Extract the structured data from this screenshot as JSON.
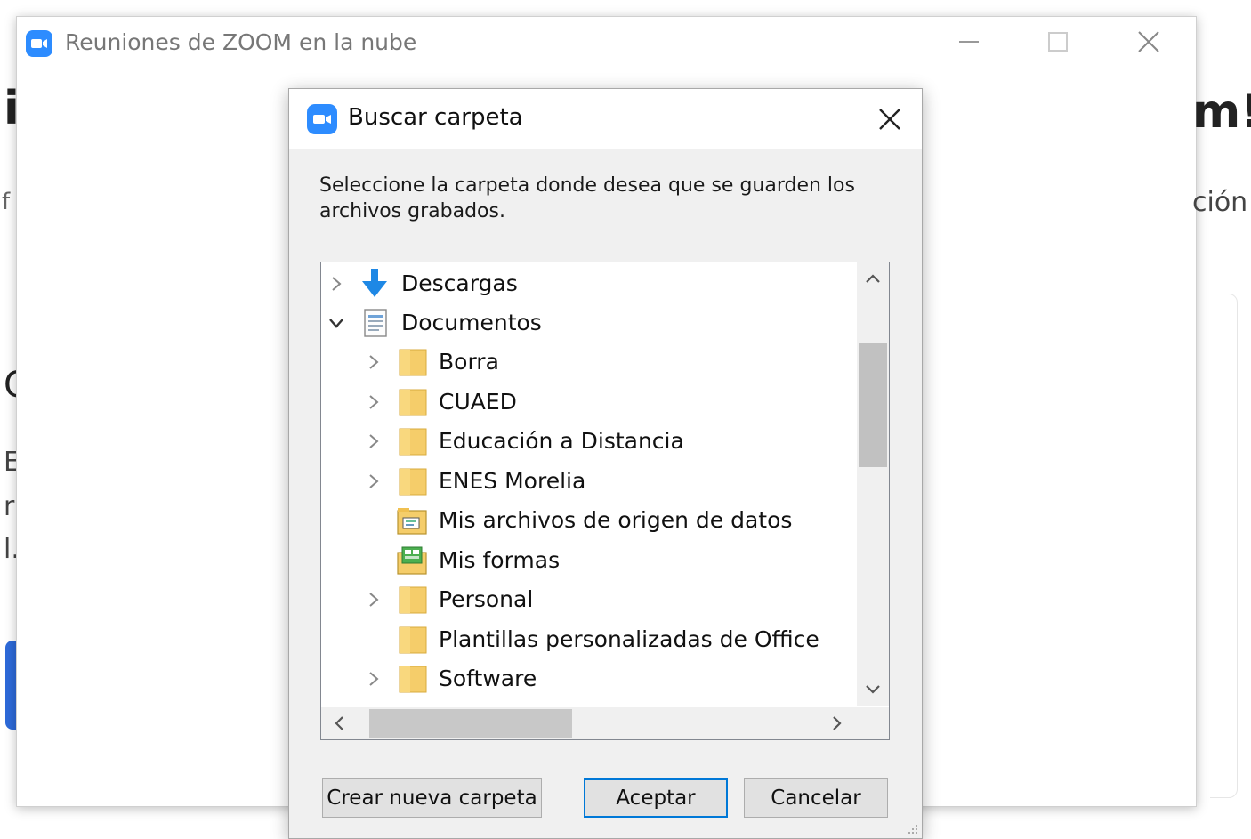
{
  "background": {
    "fragments": [
      "i",
      "f",
      "C",
      "E",
      "r",
      "l.",
      "m!",
      "ción"
    ]
  },
  "zoom_window": {
    "title": "Reuniones de ZOOM en la nube",
    "icons": {
      "app": "zoom-camera-icon",
      "minimize": "minimize-icon",
      "maximize": "maximize-icon",
      "close": "close-icon"
    }
  },
  "dialog": {
    "title": "Buscar carpeta",
    "description": "Seleccione la carpeta donde desea que se guarden los archivos grabados.",
    "tree": [
      {
        "label": "Descargas",
        "expander": "collapsed",
        "icon": "download-arrow-icon",
        "level": 0
      },
      {
        "label": "Documentos",
        "expander": "expanded",
        "icon": "document-icon",
        "level": 0
      },
      {
        "label": "Borra",
        "expander": "collapsed",
        "icon": "folder-icon",
        "level": 1
      },
      {
        "label": "CUAED",
        "expander": "collapsed",
        "icon": "folder-icon",
        "level": 1
      },
      {
        "label": "Educación a Distancia",
        "expander": "collapsed",
        "icon": "folder-icon",
        "level": 1
      },
      {
        "label": "ENES Morelia",
        "expander": "collapsed",
        "icon": "folder-icon",
        "level": 1
      },
      {
        "label": "Mis archivos de origen de datos",
        "expander": "none",
        "icon": "data-source-folder-icon",
        "level": 1
      },
      {
        "label": "Mis formas",
        "expander": "none",
        "icon": "forms-folder-icon",
        "level": 1
      },
      {
        "label": "Personal",
        "expander": "collapsed",
        "icon": "folder-icon",
        "level": 1
      },
      {
        "label": "Plantillas personalizadas de Office",
        "expander": "none",
        "icon": "folder-icon",
        "level": 1
      },
      {
        "label": "Software",
        "expander": "collapsed",
        "icon": "folder-icon",
        "level": 1
      }
    ],
    "buttons": {
      "new_folder": "Crear nueva carpeta",
      "ok": "Aceptar",
      "cancel": "Cancelar"
    },
    "colors": {
      "folder": "#f5cd6a",
      "accent": "#0078d7",
      "zoom_blue": "#2d8cff"
    }
  }
}
